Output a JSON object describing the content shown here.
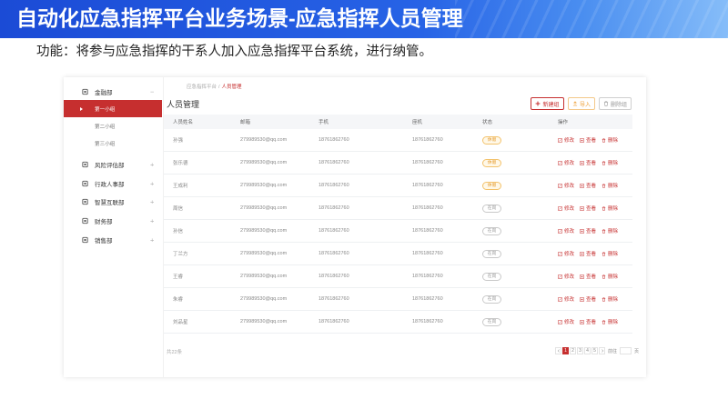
{
  "slide": {
    "title": "自动化应急指挥平台业务场景-应急指挥人员管理",
    "subtitle": "功能：将参与应急指挥的干系人加入应急指挥平台系统，进行纳管。"
  },
  "colors": {
    "accent": "#c62f2f",
    "warning": "#eea23a",
    "header_blue": "#1b4bd6",
    "header_blue_mid": "#2763e6",
    "header_blue_light": "#86bdf9"
  },
  "sidebar": {
    "groups": [
      {
        "label": "金融部",
        "toggle": "−",
        "expanded": true,
        "children": [
          {
            "label": "第一小组",
            "selected": true
          },
          {
            "label": "第二小组"
          },
          {
            "label": "第三小组"
          }
        ]
      },
      {
        "label": "风险评估部",
        "toggle": "+"
      },
      {
        "label": "行政人事部",
        "toggle": "+"
      },
      {
        "label": "智慧互联部",
        "toggle": "+"
      },
      {
        "label": "财务部",
        "toggle": "+"
      },
      {
        "label": "销售部",
        "toggle": "+"
      }
    ]
  },
  "breadcrumb": {
    "root": "应急指挥平台",
    "sep": "/",
    "current": "人员管理"
  },
  "page_title": "人员管理",
  "toolbar": {
    "new_group": "新建组",
    "new_group_icon": "plus-icon",
    "import": "导入",
    "import_icon": "upload-icon",
    "delete_group": "删除组",
    "delete_group_icon": "trash-icon"
  },
  "table": {
    "columns": [
      "人员姓名",
      "邮箱",
      "手机",
      "座机",
      "状态",
      "操作"
    ],
    "actions": [
      {
        "label": "修改",
        "icon": "edit-icon"
      },
      {
        "label": "查看",
        "icon": "view-icon"
      },
      {
        "label": "删除",
        "icon": "trash-icon"
      }
    ],
    "rows": [
      {
        "name": "孙强",
        "email": "279989530@qq.com",
        "mobile": "18761862760",
        "landline": "18761862760",
        "status": "休假",
        "status_type": "warning"
      },
      {
        "name": "张乐德",
        "email": "279989530@qq.com",
        "mobile": "18761862760",
        "landline": "18761862760",
        "status": "休假",
        "status_type": "warning"
      },
      {
        "name": "王成利",
        "email": "279989530@qq.com",
        "mobile": "18761862760",
        "landline": "18761862760",
        "status": "休假",
        "status_type": "warning"
      },
      {
        "name": "周信",
        "email": "279989530@qq.com",
        "mobile": "18761862760",
        "landline": "18761862760",
        "status": "在岗",
        "status_type": "normal"
      },
      {
        "name": "孙信",
        "email": "279989530@qq.com",
        "mobile": "18761862760",
        "landline": "18761862760",
        "status": "在岗",
        "status_type": "normal"
      },
      {
        "name": "丁兰方",
        "email": "279989530@qq.com",
        "mobile": "18761862760",
        "landline": "18761862760",
        "status": "在岗",
        "status_type": "normal"
      },
      {
        "name": "王睿",
        "email": "279989530@qq.com",
        "mobile": "18761862760",
        "landline": "18761862760",
        "status": "在岗",
        "status_type": "normal"
      },
      {
        "name": "朱睿",
        "email": "279989530@qq.com",
        "mobile": "18761862760",
        "landline": "18761862760",
        "status": "在岗",
        "status_type": "normal"
      },
      {
        "name": "刘品星",
        "email": "279989530@qq.com",
        "mobile": "18761862760",
        "landline": "18761862760",
        "status": "在岗",
        "status_type": "normal"
      }
    ]
  },
  "pagination": {
    "total": "共22条",
    "pages": [
      "1",
      "2",
      "3",
      "4",
      "5"
    ],
    "current": "1",
    "goto_label": "前往",
    "page_unit": "页",
    "prev_icon": "chevron-left-icon",
    "next_icon": "chevron-right-icon"
  }
}
